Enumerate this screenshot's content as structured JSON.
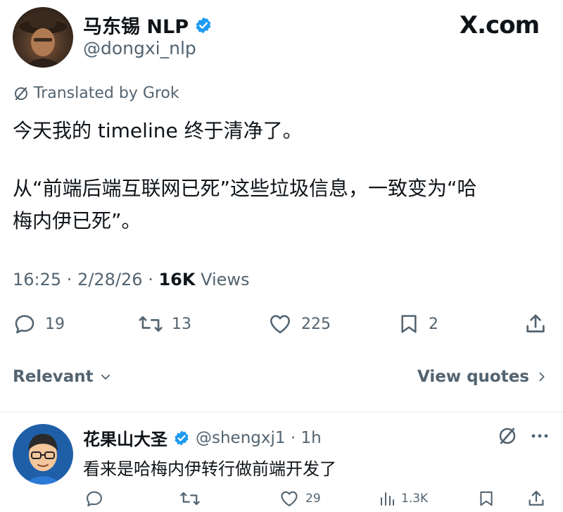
{
  "tweet": {
    "author_name": "马东锡 NLP",
    "handle": "@dongxi_nlp",
    "brand": "X.com",
    "translated_label": "Translated by Grok",
    "body_line1": "今天我的 timeline 终于清净了。",
    "body_line2": "从“前端后端互联网已死”这些垃圾信息，一致变为“哈",
    "body_line3": "梅内伊已死”。",
    "time": "16:25 · 2/28/26 · ",
    "views_count": "16K",
    "views_label": " Views",
    "stats": {
      "replies": "19",
      "retweets": "13",
      "likes": "225",
      "bookmarks": "2"
    }
  },
  "filter": {
    "relevant_label": "Relevant",
    "view_quotes_label": "View quotes"
  },
  "reply": {
    "author_name": "花果山大圣",
    "handle": "@shengxj1",
    "time": " · 1h",
    "text": "看来是哈梅内伊转行做前端开发了",
    "stats": {
      "likes": "29",
      "views": "1.3K"
    }
  },
  "colors": {
    "verified": "#1d9bf0",
    "text": "#0f1419",
    "muted": "#536471",
    "divider": "#eff3f4"
  }
}
